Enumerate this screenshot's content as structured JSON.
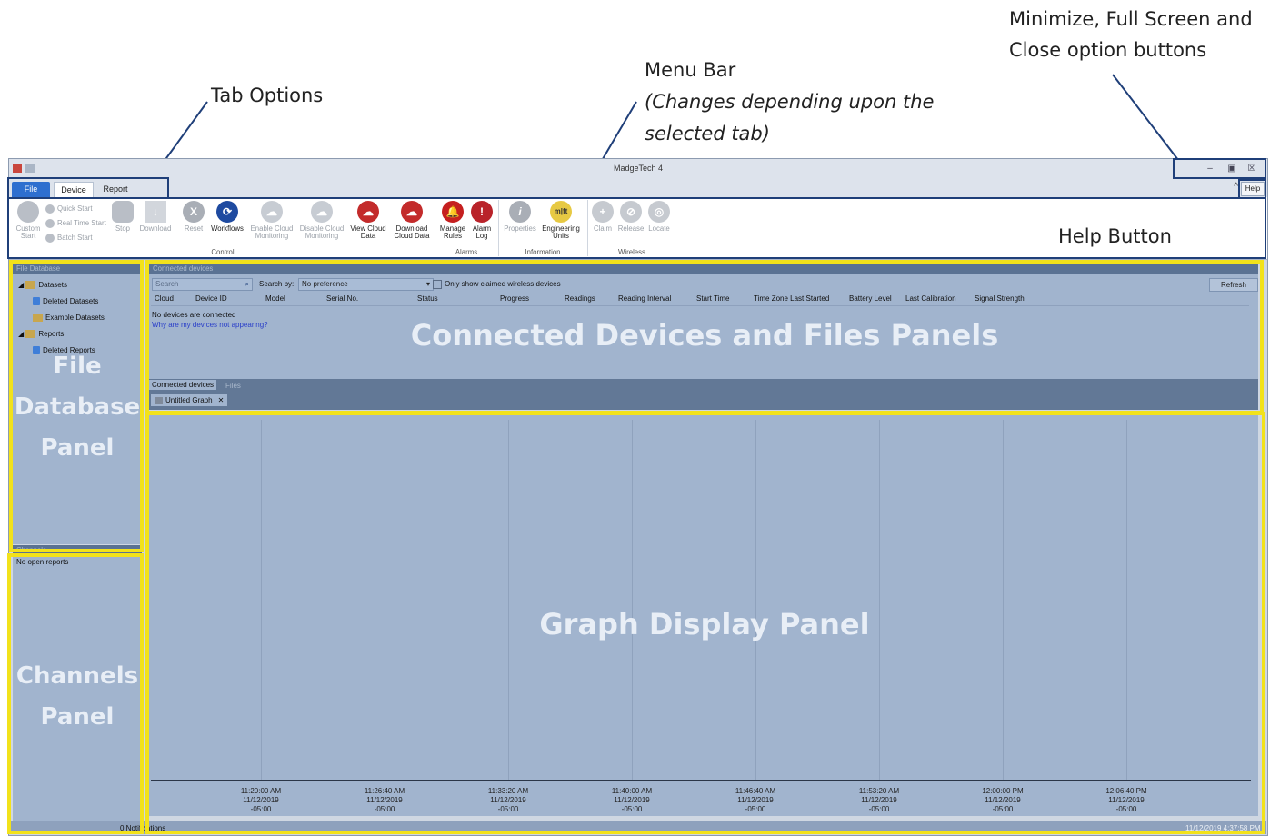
{
  "annotations": {
    "tab_options": "Tab Options",
    "menu_bar": "Menu Bar",
    "menu_bar_note1": "(Changes depending upon the",
    "menu_bar_note2": "selected tab)",
    "window_buttons1": "Minimize, Full Screen and",
    "window_buttons2": "Close option buttons",
    "help_button": "Help Button",
    "connected_panel": "Connected Devices and Files Panels",
    "file_db_panel1": "File",
    "file_db_panel2": "Database",
    "file_db_panel3": "Panel",
    "graph_panel": "Graph Display Panel",
    "channels_panel1": "Channels",
    "channels_panel2": "Panel"
  },
  "window": {
    "title": "MadgeTech 4",
    "minimize": "–",
    "maximize": "▣",
    "close": "☒",
    "help": "Help",
    "collapse": "^"
  },
  "tabs": {
    "file": "File",
    "device": "Device",
    "report": "Report"
  },
  "ribbon": {
    "custom_start": "Custom Start",
    "quick_start": "Quick Start",
    "real_time_start": "Real Time Start",
    "batch_start": "Batch Start",
    "stop": "Stop",
    "download": "Download",
    "reset": "Reset",
    "workflows": "Workflows",
    "enable_cloud": "Enable Cloud Monitoring",
    "disable_cloud": "Disable Cloud Monitoring",
    "view_cloud": "View Cloud Data",
    "download_cloud": "Download Cloud Data",
    "manage_rules": "Manage Rules",
    "alarm_log": "Alarm Log",
    "properties": "Properties",
    "engineering_units": "Engineering Units",
    "claim": "Claim",
    "release": "Release",
    "locate": "Locate",
    "groups": {
      "control": "Control",
      "alarms": "Alarms",
      "information": "Information",
      "wireless": "Wireless"
    }
  },
  "file_database": {
    "title": "File Database",
    "items": [
      "Datasets",
      "Deleted Datasets",
      "Example Datasets",
      "Reports",
      "Deleted Reports"
    ]
  },
  "channels": {
    "title": "Channels",
    "empty": "No open reports"
  },
  "connected": {
    "title": "Connected devices",
    "search_placeholder": "Search",
    "search_by_label": "Search by:",
    "search_by_value": "No preference",
    "only_claimed": "Only show claimed wireless devices",
    "refresh": "Refresh",
    "columns": [
      "Cloud",
      "Device ID",
      "Model",
      "Serial No.",
      "Status",
      "Progress",
      "Readings",
      "Reading Interval",
      "Start Time",
      "Time Zone Last Started",
      "Battery Level",
      "Last Calibration",
      "Signal Strength"
    ],
    "empty": "No devices are connected",
    "help_link": "Why are my devices not appearing?",
    "tab_connected": "Connected devices",
    "tab_files": "Files"
  },
  "graph": {
    "tab": "Untitled Graph",
    "ticks": [
      {
        "time": "11:20:00 AM",
        "date": "11/12/2019",
        "tz": "-05:00"
      },
      {
        "time": "11:26:40 AM",
        "date": "11/12/2019",
        "tz": "-05:00"
      },
      {
        "time": "11:33:20 AM",
        "date": "11/12/2019",
        "tz": "-05:00"
      },
      {
        "time": "11:40:00 AM",
        "date": "11/12/2019",
        "tz": "-05:00"
      },
      {
        "time": "11:46:40 AM",
        "date": "11/12/2019",
        "tz": "-05:00"
      },
      {
        "time": "11:53:20 AM",
        "date": "11/12/2019",
        "tz": "-05:00"
      },
      {
        "time": "12:00:00 PM",
        "date": "11/12/2019",
        "tz": "-05:00"
      },
      {
        "time": "12:06:40 PM",
        "date": "11/12/2019",
        "tz": "-05:00"
      }
    ]
  },
  "status": {
    "notifications": "0 Notifications",
    "clock": "11/12/2019 4:37:58 PM"
  },
  "colors": {
    "highlight": "#f2e21b",
    "callout": "#1f3f79",
    "panel": "#a1b4ce"
  }
}
